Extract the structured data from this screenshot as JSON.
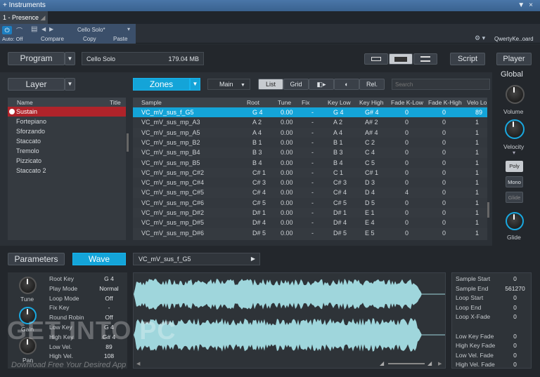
{
  "window": {
    "title": "Instruments",
    "pin": "▼",
    "close": "×"
  },
  "tab": {
    "label": "1 - Presence"
  },
  "toolbar": {
    "auto": "Auto: Off",
    "preset_name": "Cello Solo*",
    "compare": "Compare",
    "copy": "Copy",
    "paste": "Paste",
    "keyboard": "QwertyKe..oard"
  },
  "program": {
    "label": "Program",
    "name": "Cello Solo",
    "size": "179.04 MB"
  },
  "top_right": {
    "script": "Script",
    "player": "Player"
  },
  "layer": {
    "label": "Layer",
    "col_name": "Name",
    "col_title": "Title",
    "items": [
      "Sustain",
      "Fortepiano",
      "Sforzando",
      "Staccato",
      "Tremolo",
      "Pizzicato",
      "Staccato 2"
    ],
    "selected": 0
  },
  "zones": {
    "label": "Zones",
    "mode": "Main",
    "list": "List",
    "grid": "Grid",
    "rel": "Rel.",
    "search_placeholder": "Search"
  },
  "table": {
    "headers": [
      "Sample",
      "Root",
      "Tune",
      "Fix",
      "Key Low",
      "Key High",
      "Fade K-Low",
      "Fade K-High",
      "Velo Lo"
    ],
    "rows": [
      [
        "VC_mV_sus_f_G5",
        "G 4",
        "0.00",
        "-",
        "G 4",
        "G# 4",
        "0",
        "0",
        "89"
      ],
      [
        "VC_mV_sus_mp_A3",
        "A 2",
        "0.00",
        "-",
        "A 2",
        "A# 2",
        "0",
        "0",
        "1"
      ],
      [
        "VC_mV_sus_mp_A5",
        "A 4",
        "0.00",
        "-",
        "A 4",
        "A# 4",
        "0",
        "0",
        "1"
      ],
      [
        "VC_mV_sus_mp_B2",
        "B 1",
        "0.00",
        "-",
        "B 1",
        "C 2",
        "0",
        "0",
        "1"
      ],
      [
        "VC_mV_sus_mp_B4",
        "B 3",
        "0.00",
        "-",
        "B 3",
        "C 4",
        "0",
        "0",
        "1"
      ],
      [
        "VC_mV_sus_mp_B5",
        "B 4",
        "0.00",
        "-",
        "B 4",
        "C 5",
        "0",
        "0",
        "1"
      ],
      [
        "VC_mV_sus_mp_C#2",
        "C# 1",
        "0.00",
        "-",
        "C 1",
        "C# 1",
        "0",
        "0",
        "1"
      ],
      [
        "VC_mV_sus_mp_C#4",
        "C# 3",
        "0.00",
        "-",
        "C# 3",
        "D 3",
        "0",
        "0",
        "1"
      ],
      [
        "VC_mV_sus_mp_C#5",
        "C# 4",
        "0.00",
        "-",
        "C# 4",
        "D 4",
        "4",
        "0",
        "1"
      ],
      [
        "VC_mV_sus_mp_C#6",
        "C# 5",
        "0.00",
        "-",
        "C# 5",
        "D 5",
        "0",
        "0",
        "1"
      ],
      [
        "VC_mV_sus_mp_D#2",
        "D# 1",
        "0.00",
        "-",
        "D# 1",
        "E 1",
        "0",
        "0",
        "1"
      ],
      [
        "VC_mV_sus_mp_D#5",
        "D# 4",
        "0.00",
        "-",
        "D# 4",
        "E 4",
        "0",
        "0",
        "1"
      ],
      [
        "VC_mV_sus_mp_D#6",
        "D# 5",
        "0.00",
        "-",
        "D# 5",
        "E 5",
        "0",
        "0",
        "1"
      ]
    ]
  },
  "global": {
    "label": "Global",
    "volume": "Volume",
    "velocity": "Velocity",
    "poly": "Poly",
    "mono": "Mono",
    "glide_btn": "Glide",
    "glide": "Glide"
  },
  "bottom": {
    "parameters": "Parameters",
    "wave": "Wave",
    "sample_name": "VC_mV_sus_f_G5",
    "tune": "Tune",
    "gain": "Gain",
    "pan": "Pan"
  },
  "params": [
    [
      "Root Key",
      "G 4"
    ],
    [
      "Play Mode",
      "Normal"
    ],
    [
      "Loop Mode",
      "Off"
    ],
    [
      "Fix Key",
      "-"
    ],
    [
      "Round Robin",
      "Off"
    ],
    [
      "Low Key",
      "G 4"
    ],
    [
      "High Key",
      "G# 4"
    ],
    [
      "Low Vel.",
      "89"
    ],
    [
      "High Vel.",
      "108"
    ]
  ],
  "sample_info": [
    [
      "Sample Start",
      "0"
    ],
    [
      "Sample End",
      "561270"
    ],
    [
      "Loop Start",
      "0"
    ],
    [
      "Loop End",
      "0"
    ],
    [
      "Loop X-Fade",
      "0"
    ],
    [
      "",
      ""
    ],
    [
      "Low Key Fade",
      "0"
    ],
    [
      "High Key Fade",
      "0"
    ],
    [
      "Low Vel. Fade",
      "0"
    ],
    [
      "High Vel. Fade",
      "0"
    ]
  ],
  "watermark": {
    "title": "GET INTO PC",
    "subtitle": "Download Free Your Desired App"
  }
}
